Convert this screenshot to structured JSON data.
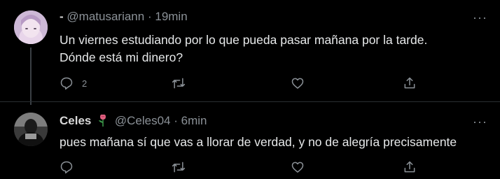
{
  "tweets": [
    {
      "name": "-",
      "handle": "@matusariann",
      "separator": "·",
      "time": "19min",
      "text_line1": "Un viernes estudiando por lo que pueda pasar mañana por la tarde.",
      "text_line2": "Dónde está mi dinero?",
      "reply_count": "2",
      "more": "···"
    },
    {
      "name": "Celes",
      "emoji": "rose-emoji",
      "handle": "@Celes04",
      "separator": "·",
      "time": "6min",
      "text": "pues mañana sí que vas a llorar de verdad, y no de alegría precisamente",
      "more": "···"
    }
  ],
  "colors": {
    "background": "#000000",
    "text": "#e7e9ea",
    "secondary": "#8b9197",
    "divider": "#2a2f33"
  },
  "icons": [
    "reply-icon",
    "retweet-icon",
    "like-icon",
    "share-icon",
    "more-icon"
  ]
}
